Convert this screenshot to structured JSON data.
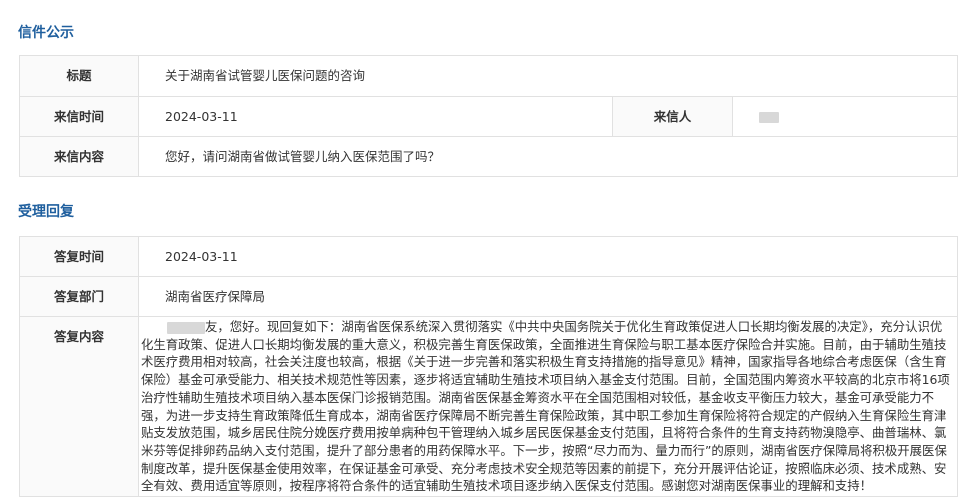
{
  "sections": {
    "public_letter": "信件公示",
    "reply": "受理回复"
  },
  "letter": {
    "title_label": "标题",
    "title_value": "关于湖南省试管婴儿医保问题的咨询",
    "date_label": "来信时间",
    "date_value": "2024-03-11",
    "sender_label": "来信人",
    "content_label": "来信内容",
    "content_value": "您好，请问湖南省做试管婴儿纳入医保范围了吗？"
  },
  "response": {
    "date_label": "答复时间",
    "date_value": "2024-03-11",
    "dept_label": "答复部门",
    "dept_value": "湖南省医疗保障局",
    "content_label": "答复内容",
    "content_value": "友，您好。现回复如下：湖南省医保系统深入贯彻落实《中共中央国务院关于优化生育政策促进人口长期均衡发展的决定》，充分认识优化生育政策、促进人口长期均衡发展的重大意义，积极完善生育医保政策，全面推进生育保险与职工基本医疗保险合并实施。目前，由于辅助生殖技术医疗费用相对较高，社会关注度也较高，根据《关于进一步完善和落实积极生育支持措施的指导意见》精神，国家指导各地综合考虑医保（含生育保险）基金可承受能力、相关技术规范性等因素，逐步将适宜辅助生殖技术项目纳入基金支付范围。目前，全国范围内筹资水平较高的北京市将16项治疗性辅助生殖技术项目纳入基本医保门诊报销范围。湖南省医保基金筹资水平在全国范围相对较低，基金收支平衡压力较大，基金可承受能力不强，为进一步支持生育政策降低生育成本，湖南省医疗保障局不断完善生育保险政策，其中职工参加生育保险将符合规定的产假纳入生育保险生育津贴支发放范围，城乡居民住院分娩医疗费用按单病种包干管理纳入城乡居民医保基金支付范围，且将符合条件的生育支持药物溴隐亭、曲普瑞林、氯米芬等促排卵药品纳入支付范围，提升了部分患者的用药保障水平。下一步，按照“尽力而为、量力而行”的原则，湖南省医疗保障局将积极开展医保制度改革，提升医保基金使用效率，在保证基金可承受、充分考虑技术安全规范等因素的前提下，充分开展评估论证，按照临床必须、技术成熟、安全有效、费用适宜等原则，按程序将符合条件的适宜辅助生殖技术项目逐步纳入医保支付范围。感谢您对湖南医保事业的理解和支持！"
  }
}
